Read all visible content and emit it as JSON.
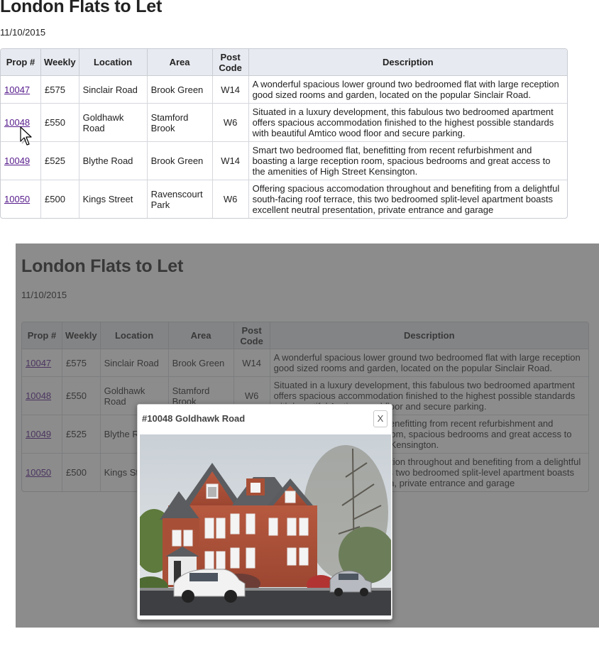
{
  "page": {
    "title": "London Flats to Let",
    "date": "11/10/2015"
  },
  "table": {
    "headers": {
      "prop": "Prop #",
      "weekly": "Weekly",
      "location": "Location",
      "area": "Area",
      "post_code_line1": "Post",
      "post_code_line2": "Code",
      "description": "Description"
    },
    "rows": [
      {
        "prop": "10047",
        "weekly": "£575",
        "location": "Sinclair Road",
        "area": "Brook Green",
        "post_code": "W14",
        "description": "A wonderful spacious lower ground two bedroomed flat with large reception good sized rooms and garden, located on the popular Sinclair Road."
      },
      {
        "prop": "10048",
        "weekly": "£550",
        "location": "Goldhawk Road",
        "area": "Stamford Brook",
        "post_code": "W6",
        "description": "Situated in a luxury development, this fabulous two bedroomed apartment offers spacious accommodation finished to the highest possible standards with beautiful Amtico wood floor and secure parking."
      },
      {
        "prop": "10049",
        "weekly": "£525",
        "location": "Blythe Road",
        "area": "Brook Green",
        "post_code": "W14",
        "description": "Smart two bedroomed flat, benefitting from recent refurbishment and boasting a large reception room, spacious bedrooms and great access to the amenities of High Street Kensington."
      },
      {
        "prop": "10050",
        "weekly": "£500",
        "location": "Kings Street",
        "area": "Ravenscourt Park",
        "post_code": "W6",
        "description": "Offering spacious accomodation throughout and benefiting from a delightful south-facing roof terrace, this two bedroomed split-level apartment boasts excellent neutral presentation, private entrance and garage"
      }
    ]
  },
  "dialog": {
    "title": "#10048 Goldhawk Road",
    "close_label": "X",
    "photo_icon": "house-photo"
  },
  "colors": {
    "header_bg": "#e7eaf0",
    "link": "#551a8b",
    "overlay": "#464646",
    "brick": "#b4563e"
  }
}
